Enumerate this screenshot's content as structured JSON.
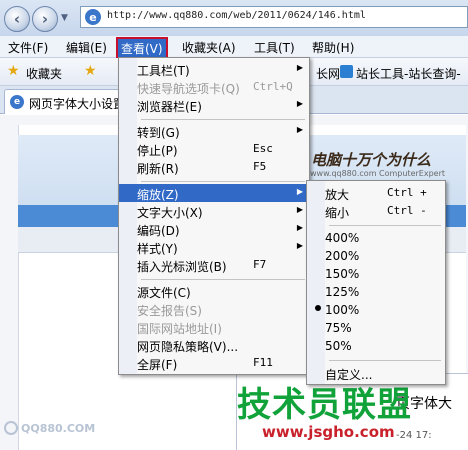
{
  "window": {
    "url": "http://www.qq880.com/web/2011/0624/146.html",
    "url_icon": "e"
  },
  "toolbar": {
    "back_icon": "‹",
    "forward_icon": "›",
    "dropdown_icon": "▼"
  },
  "menubar": {
    "items": [
      "文件(F)",
      "编辑(E)",
      "查看(V)",
      "收藏夹(A)",
      "工具(T)",
      "帮助(H)"
    ]
  },
  "favorites": {
    "label": "收藏夹",
    "item1": "长网",
    "item2": "站长工具-站长查询-"
  },
  "tab": {
    "label": "网页字体大小设置",
    "icon": "e"
  },
  "page": {
    "slogan": "电脑十万个为什么",
    "slogan_sub": "www.qq880.com ComputerExpert",
    "heading": "页字体大",
    "date": "-24 17:",
    "logo_text": "QQ880.COM",
    "watermark_title": "技术员联盟",
    "watermark_url": "www.jsgho.com"
  },
  "view_menu": {
    "items": [
      {
        "label": "工具栏(T)",
        "shortcut": "",
        "submenu": true,
        "disabled": false
      },
      {
        "label": "快速导航选项卡(Q)",
        "shortcut": "Ctrl+Q",
        "submenu": false,
        "disabled": true
      },
      {
        "label": "浏览器栏(E)",
        "shortcut": "",
        "submenu": true,
        "disabled": false
      },
      {
        "label": "转到(G)",
        "shortcut": "",
        "submenu": true,
        "disabled": false
      },
      {
        "label": "停止(P)",
        "shortcut": "Esc",
        "submenu": false,
        "disabled": false
      },
      {
        "label": "刷新(R)",
        "shortcut": "F5",
        "submenu": false,
        "disabled": false
      },
      {
        "label": "缩放(Z)",
        "shortcut": "",
        "submenu": true,
        "disabled": false
      },
      {
        "label": "文字大小(X)",
        "shortcut": "",
        "submenu": true,
        "disabled": false
      },
      {
        "label": "编码(D)",
        "shortcut": "",
        "submenu": true,
        "disabled": false
      },
      {
        "label": "样式(Y)",
        "shortcut": "",
        "submenu": true,
        "disabled": false
      },
      {
        "label": "插入光标浏览(B)",
        "shortcut": "F7",
        "submenu": false,
        "disabled": false
      },
      {
        "label": "源文件(C)",
        "shortcut": "",
        "submenu": false,
        "disabled": false
      },
      {
        "label": "安全报告(S)",
        "shortcut": "",
        "submenu": false,
        "disabled": true
      },
      {
        "label": "国际网站地址(I)",
        "shortcut": "",
        "submenu": false,
        "disabled": true
      },
      {
        "label": "网页隐私策略(V)...",
        "shortcut": "",
        "submenu": false,
        "disabled": false
      },
      {
        "label": "全屏(F)",
        "shortcut": "F11",
        "submenu": false,
        "disabled": false
      }
    ]
  },
  "zoom_menu": {
    "items": [
      {
        "label": "放大",
        "shortcut": "Ctrl +"
      },
      {
        "label": "缩小",
        "shortcut": "Ctrl -"
      },
      {
        "label": "400%",
        "shortcut": ""
      },
      {
        "label": "200%",
        "shortcut": ""
      },
      {
        "label": "150%",
        "shortcut": ""
      },
      {
        "label": "125%",
        "shortcut": ""
      },
      {
        "label": "100%",
        "shortcut": "",
        "selected": true
      },
      {
        "label": "75%",
        "shortcut": ""
      },
      {
        "label": "50%",
        "shortcut": ""
      },
      {
        "label": "自定义...",
        "shortcut": ""
      }
    ]
  },
  "colors": {
    "highlight": "#3169c6",
    "active_menu_border": "#c8102e",
    "watermark_green": "#11a33a",
    "watermark_red": "#c9212b"
  }
}
